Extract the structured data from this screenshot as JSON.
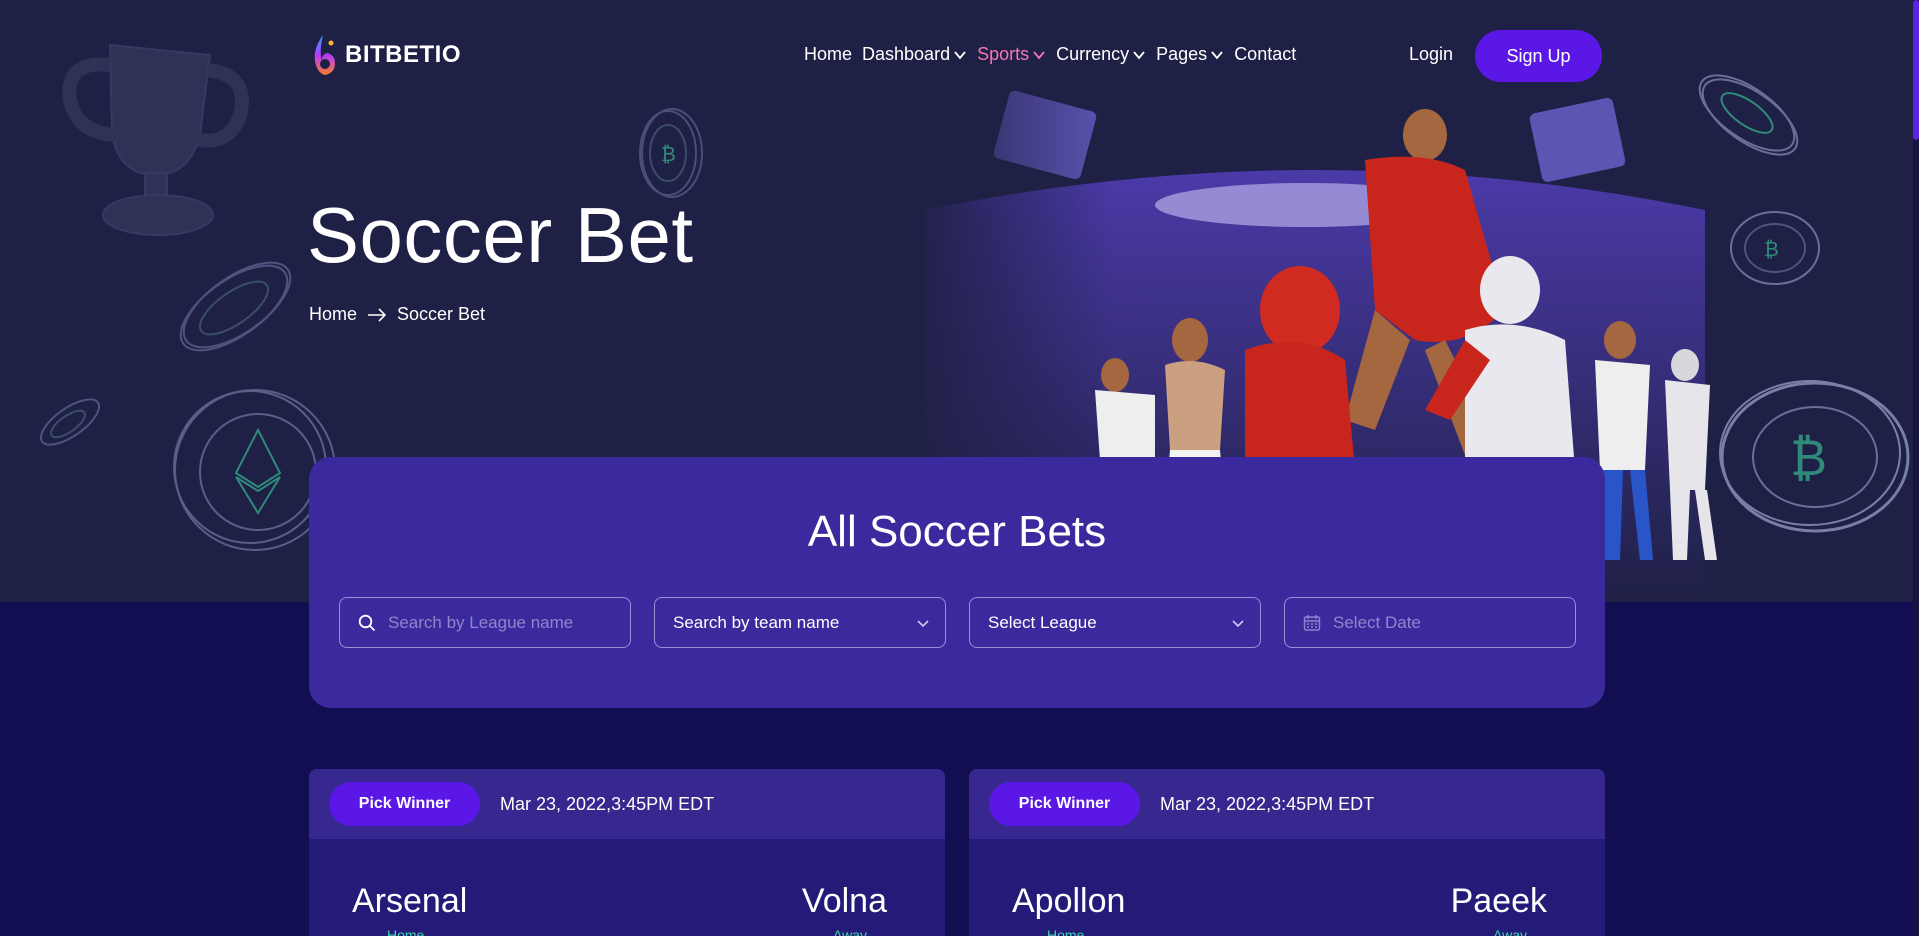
{
  "brand": {
    "name": "BITBETIO"
  },
  "nav": {
    "items": [
      {
        "label": "Home",
        "has_menu": false,
        "active": false
      },
      {
        "label": "Dashboard",
        "has_menu": true,
        "active": false
      },
      {
        "label": "Sports",
        "has_menu": true,
        "active": true
      },
      {
        "label": "Currency",
        "has_menu": true,
        "active": false
      },
      {
        "label": "Pages",
        "has_menu": true,
        "active": false
      },
      {
        "label": "Contact",
        "has_menu": false,
        "active": false
      }
    ],
    "login_label": "Login",
    "signup_label": "Sign Up"
  },
  "hero": {
    "title": "Soccer Bet",
    "breadcrumb": {
      "home": "Home",
      "current": "Soccer Bet"
    }
  },
  "filters": {
    "title": "All Soccer Bets",
    "league_search_placeholder": "Search by League name",
    "team_select_value": "Search by team name",
    "league_select_value": "Select League",
    "date_placeholder": "Select Date"
  },
  "matches": [
    {
      "pick_label": "Pick Winner",
      "date": "Mar 23, 2022,3:45PM EDT",
      "home_team": "Arsenal",
      "away_team": "Volna",
      "home_label": "Home",
      "away_label": "Away"
    },
    {
      "pick_label": "Pick Winner",
      "date": "Mar 23, 2022,3:45PM EDT",
      "home_team": "Apollon",
      "away_team": "Paeek",
      "home_label": "Home",
      "away_label": "Away"
    }
  ],
  "colors": {
    "hero_bg": "#1f2045",
    "page_bg": "#120e52",
    "panel_bg": "#3a2a9e",
    "accent": "#5b17e6",
    "active_nav": "#f577b4",
    "label_green": "#3fd6b0"
  }
}
